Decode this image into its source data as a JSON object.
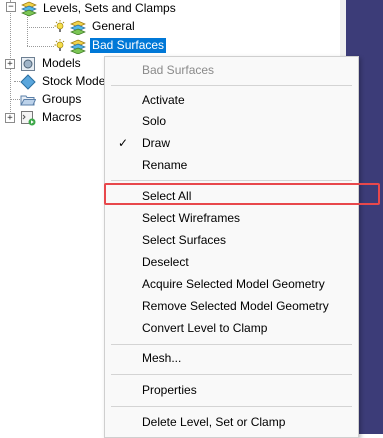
{
  "tree": {
    "items": [
      {
        "label": "Levels, Sets and Clamps",
        "expander": "−"
      },
      {
        "label": "General"
      },
      {
        "label": "Bad Surfaces"
      },
      {
        "label": "Models",
        "expander": "+"
      },
      {
        "label": "Stock Mode"
      },
      {
        "label": "Groups"
      },
      {
        "label": "Macros",
        "expander": "+"
      }
    ]
  },
  "context_menu": {
    "header": "Bad Surfaces",
    "check_mark": "✓",
    "items": [
      {
        "label": "Activate"
      },
      {
        "label": "Solo"
      },
      {
        "label": "Draw",
        "checked": true
      },
      {
        "label": "Rename"
      },
      {
        "label": "Select All",
        "highlighted": true
      },
      {
        "label": "Select Wireframes"
      },
      {
        "label": "Select Surfaces"
      },
      {
        "label": "Deselect"
      },
      {
        "label": "Acquire Selected Model Geometry"
      },
      {
        "label": "Remove Selected Model Geometry"
      },
      {
        "label": "Convert Level to Clamp"
      },
      {
        "label": "Mesh..."
      },
      {
        "label": "Properties"
      },
      {
        "label": "Delete Level, Set or Clamp"
      }
    ]
  },
  "colors": {
    "selection": "#0078d7",
    "highlight_border": "#e8484c",
    "right_panel": "#3c3c78"
  }
}
